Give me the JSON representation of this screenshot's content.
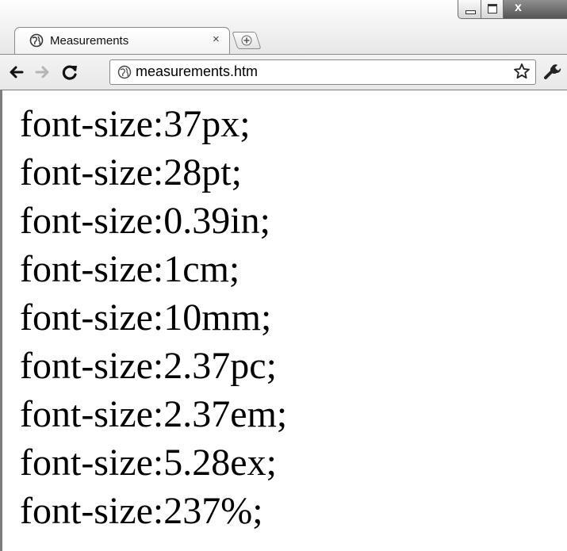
{
  "tab": {
    "title": "Measurements",
    "close_glyph": "×"
  },
  "window_controls": {
    "close_glyph": "x"
  },
  "toolbar": {
    "url": "measurements.htm"
  },
  "icons": {
    "tab_favicon": "globe-icon",
    "new_tab": "new-tab-icon",
    "back": "back-arrow-icon",
    "forward": "forward-arrow-icon",
    "reload": "reload-icon",
    "page_icon": "page-globe-icon",
    "bookmark": "star-icon",
    "menu": "wrench-icon"
  },
  "content": {
    "lines": [
      "font-size:37px;",
      "font-size:28pt;",
      "font-size:0.39in;",
      "font-size:1cm;",
      "font-size:10mm;",
      "font-size:2.37pc;",
      "font-size:2.37em;",
      "font-size:5.28ex;",
      "font-size:237%;"
    ]
  }
}
